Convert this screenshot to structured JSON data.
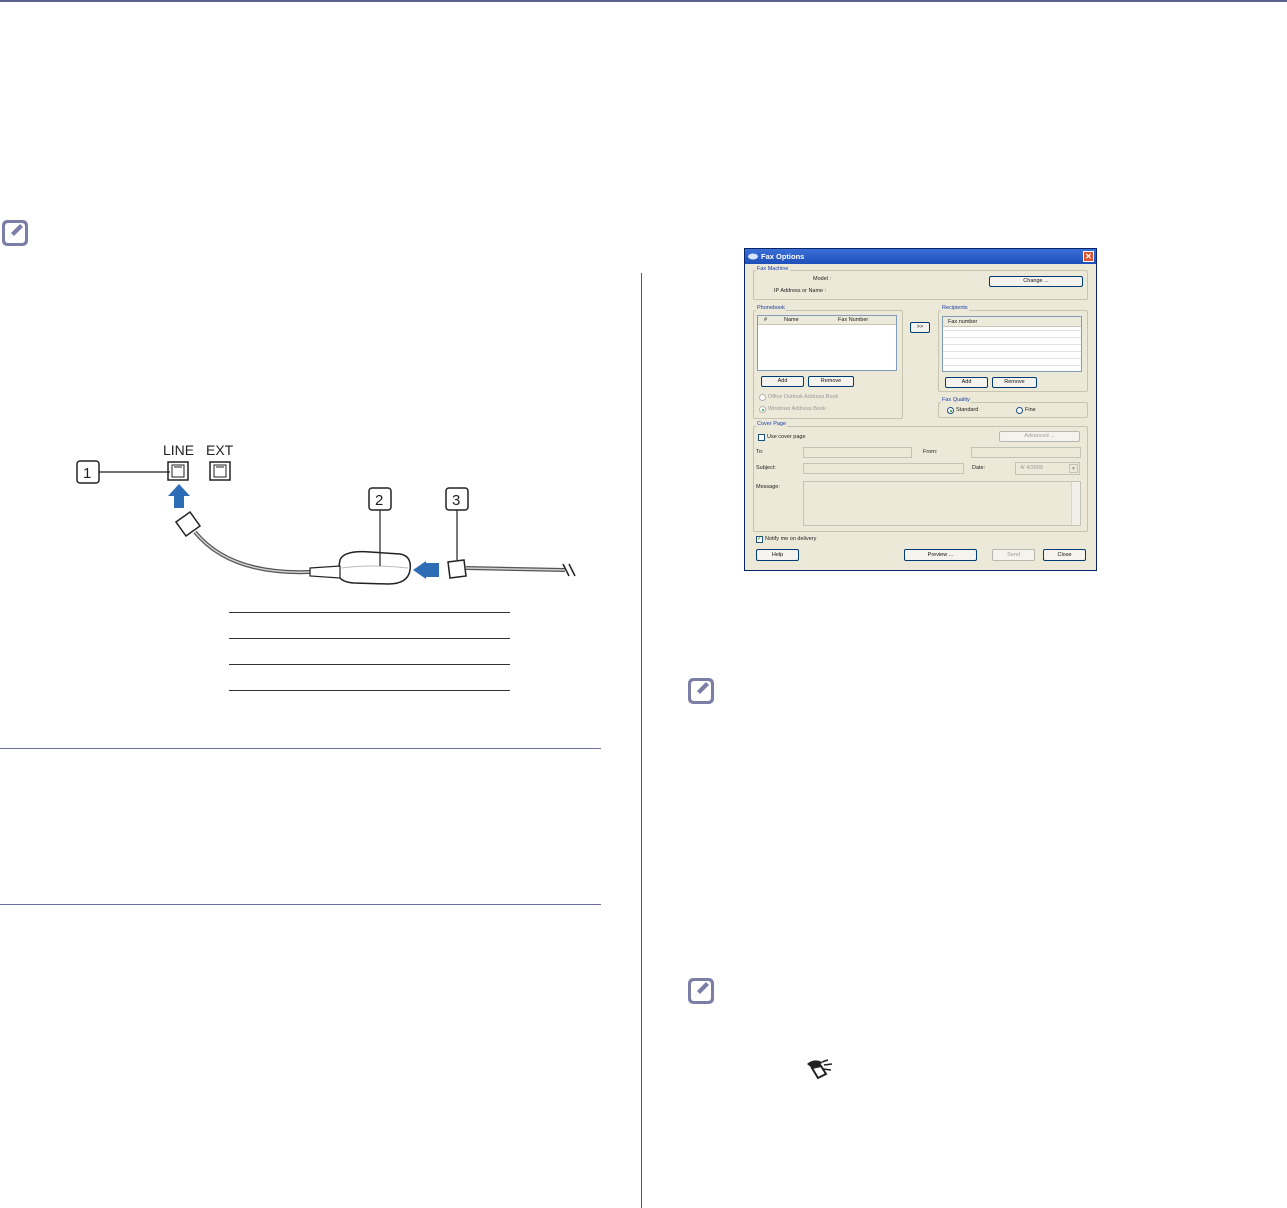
{
  "figure": {
    "line_label": "LINE",
    "ext_label": "EXT",
    "callouts": [
      "1",
      "2",
      "3"
    ]
  },
  "fax_dialog": {
    "title": "Fax Options",
    "fax_machine": {
      "group": "Fax Machine",
      "model_label": "Model :",
      "ip_label": "IP Address or Name :",
      "change_button": "Change ..."
    },
    "phonebook": {
      "group": "Phonebook",
      "columns": [
        "#",
        "Name",
        "Fax Number"
      ],
      "add_button": "Add",
      "remove_button": "Remove",
      "source_outlook": "Office Outlook Address Book",
      "source_windows": "Windows Address Book"
    },
    "transfer_button": ">>",
    "recipients": {
      "group": "Recipients",
      "column": "Fax number",
      "add_button": "Add",
      "remove_button": "Remove"
    },
    "fax_quality": {
      "group": "Fax Quality",
      "standard": "Standard",
      "fine": "Fine",
      "selected": "Standard"
    },
    "cover_page": {
      "group": "Cover Page",
      "use_cover": "Use cover page",
      "advanced_button": "Advanced ...",
      "to_label": "To:",
      "from_label": "From:",
      "subject_label": "Subject:",
      "date_label": "Date:",
      "date_value": "4/ 4/2009",
      "message_label": "Message:"
    },
    "notify": "Notify me on delivery",
    "help_button": "Help",
    "preview_button": "Preview ...",
    "send_button": "Send",
    "close_button": "Close"
  },
  "colors": {
    "rule": "#5a5f8e",
    "arrow": "#2d6db5",
    "title_bar": "#2a5fcc"
  }
}
